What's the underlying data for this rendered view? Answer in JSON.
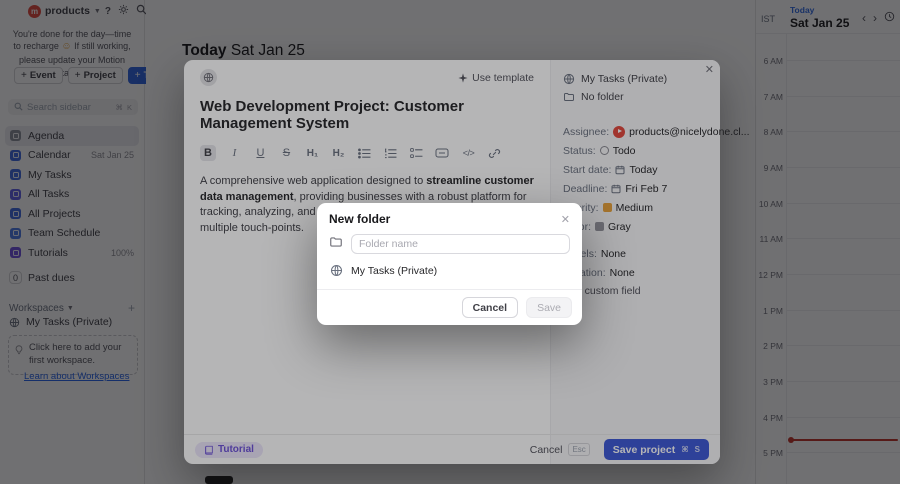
{
  "app": {
    "topbar": {
      "workspace": "products"
    },
    "notice": {
      "pre": "You're done for the day—time to recharge",
      "emoji": "☺",
      "post": "If still working, please update your Motion tasks"
    },
    "actions": {
      "plus": "+",
      "event": "Event",
      "project": "Project",
      "task": "Task"
    },
    "search": {
      "placeholder": "Search sidebar",
      "shortcut_mod": "⌘",
      "shortcut_key": "K"
    },
    "nav": [
      {
        "label": "Agenda",
        "meta": ""
      },
      {
        "label": "Calendar",
        "meta": "Sat Jan 25"
      },
      {
        "label": "My Tasks",
        "meta": ""
      },
      {
        "label": "All Tasks",
        "meta": ""
      },
      {
        "label": "All Projects",
        "meta": ""
      },
      {
        "label": "Team Schedule",
        "meta": ""
      },
      {
        "label": "Tutorials",
        "meta": "100%"
      }
    ],
    "past_dues": {
      "count": "0",
      "label": "Past dues"
    },
    "workspaces": {
      "header": "Workspaces",
      "add": "+",
      "item": "My Tasks (Private)",
      "hint": "Click here to add your first workspace.",
      "link": "Learn about Workspaces"
    },
    "main_header": {
      "today": "Today",
      "date": "Sat Jan 25"
    }
  },
  "calendar": {
    "timezone": "IST",
    "today_label": "Today",
    "date": "Sat Jan 25",
    "hours": [
      "6 AM",
      "7 AM",
      "8 AM",
      "9 AM",
      "10 AM",
      "11 AM",
      "12 PM",
      "1 PM",
      "2 PM",
      "3 PM",
      "4 PM",
      "5 PM"
    ]
  },
  "modal": {
    "use_template": "Use template",
    "title": "Web Development Project: Customer Management System",
    "toolbar": {
      "bold": "B",
      "italic": "I",
      "underline": "U",
      "strike": "S",
      "h1": "H₁",
      "h2": "H₂",
      "code": "</>"
    },
    "description": {
      "prefix": "A comprehensive web application designed to ",
      "bold": "streamline customer data management",
      "suffix": ", providing businesses with a robust platform for tracking, analyzing, and interacting with customer information across multiple touch-points."
    },
    "panel": {
      "workspace": "My Tasks (Private)",
      "folder": "No folder",
      "fields": [
        {
          "label": "Assignee:",
          "value": "products@nicelydone.cl..."
        },
        {
          "label": "Status:",
          "value": "Todo"
        },
        {
          "label": "Start date:",
          "value": "Today"
        },
        {
          "label": "Deadline:",
          "value": "Fri Feb 7"
        },
        {
          "label": "Priority:",
          "value": "Medium"
        },
        {
          "label": "Color:",
          "value": "Gray"
        },
        {
          "label": "Labels:",
          "value": "None"
        },
        {
          "label": "Duration:",
          "value": "None"
        }
      ],
      "add_custom_field": "Add custom field"
    },
    "footer": {
      "tutorial": "Tutorial",
      "cancel": "Cancel",
      "esc": "Esc",
      "save": "Save project",
      "shortcut_mod": "⌘",
      "shortcut_key": "S"
    }
  },
  "dialog": {
    "title": "New folder",
    "input_placeholder": "Folder name",
    "workspace_option": "My Tasks (Private)",
    "cancel": "Cancel",
    "save": "Save"
  },
  "colors": {
    "accent_blue": "#2e63e0",
    "save_button": "#3e59d6",
    "brand_red": "#e2483d",
    "priority_medium": "#e8a33b",
    "color_gray": "#96969e",
    "now_line": "#c13328",
    "tutorial_purple": "#6d52d8"
  }
}
